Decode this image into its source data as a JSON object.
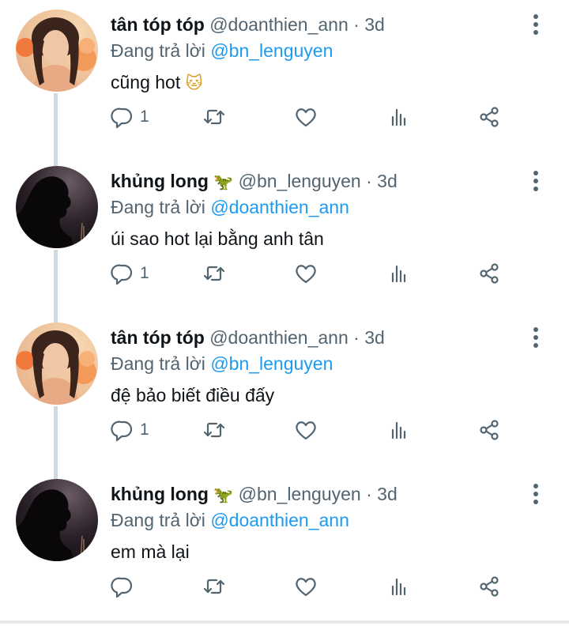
{
  "reply_prefix": "Đang trả lời",
  "tweets": [
    {
      "name": "tân tóp tóp",
      "badge": "",
      "handle": "@doanthien_ann",
      "time": "3d",
      "reply_to": "@bn_lenguyen",
      "text": "cũng hot",
      "text_emoji": "🐱",
      "reply_count": "1",
      "avatar": "avatar-girl-flowers"
    },
    {
      "name": "khủng long",
      "badge": "🦖",
      "handle": "@bn_lenguyen",
      "time": "3d",
      "reply_to": "@doanthien_ann",
      "text": "úi sao hot lại bằng anh tân",
      "text_emoji": "",
      "reply_count": "1",
      "avatar": "avatar-silhouette"
    },
    {
      "name": "tân tóp tóp",
      "badge": "",
      "handle": "@doanthien_ann",
      "time": "3d",
      "reply_to": "@bn_lenguyen",
      "text": "đệ bảo biết điều đấy",
      "text_emoji": "",
      "reply_count": "1",
      "avatar": "avatar-girl-flowers"
    },
    {
      "name": "khủng long",
      "badge": "🦖",
      "handle": "@bn_lenguyen",
      "time": "3d",
      "reply_to": "@doanthien_ann",
      "text": "em mà lại",
      "text_emoji": "",
      "reply_count": "",
      "avatar": "avatar-silhouette"
    }
  ],
  "icons": [
    "more-vertical-icon",
    "reply-icon",
    "retweet-icon",
    "heart-icon",
    "stats-icon",
    "share-icon"
  ],
  "colors": {
    "link": "#1d9bf0",
    "muted": "#536471",
    "text": "#0f1419",
    "thread": "#cfd9de"
  }
}
